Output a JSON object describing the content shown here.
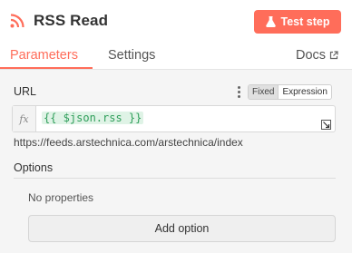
{
  "header": {
    "title": "RSS Read",
    "test_button_label": "Test step"
  },
  "tabs": {
    "parameters": "Parameters",
    "settings": "Settings",
    "docs": "Docs"
  },
  "url_param": {
    "label": "URL",
    "mode_fixed": "Fixed",
    "mode_expression": "Expression",
    "fx_label": "fx",
    "expression": "{{ $json.rss }}",
    "resolved_value": "https://feeds.arstechnica.com/arstechnica/index"
  },
  "options": {
    "label": "Options",
    "empty_text": "No properties",
    "add_button_label": "Add option"
  },
  "colors": {
    "accent": "#ff6d5a",
    "expression_bg": "#dff3e6",
    "expression_text": "#2f9e5a"
  },
  "icons": [
    "rss-icon",
    "flask-icon",
    "external-link-icon",
    "kebab-icon",
    "expand-icon"
  ]
}
